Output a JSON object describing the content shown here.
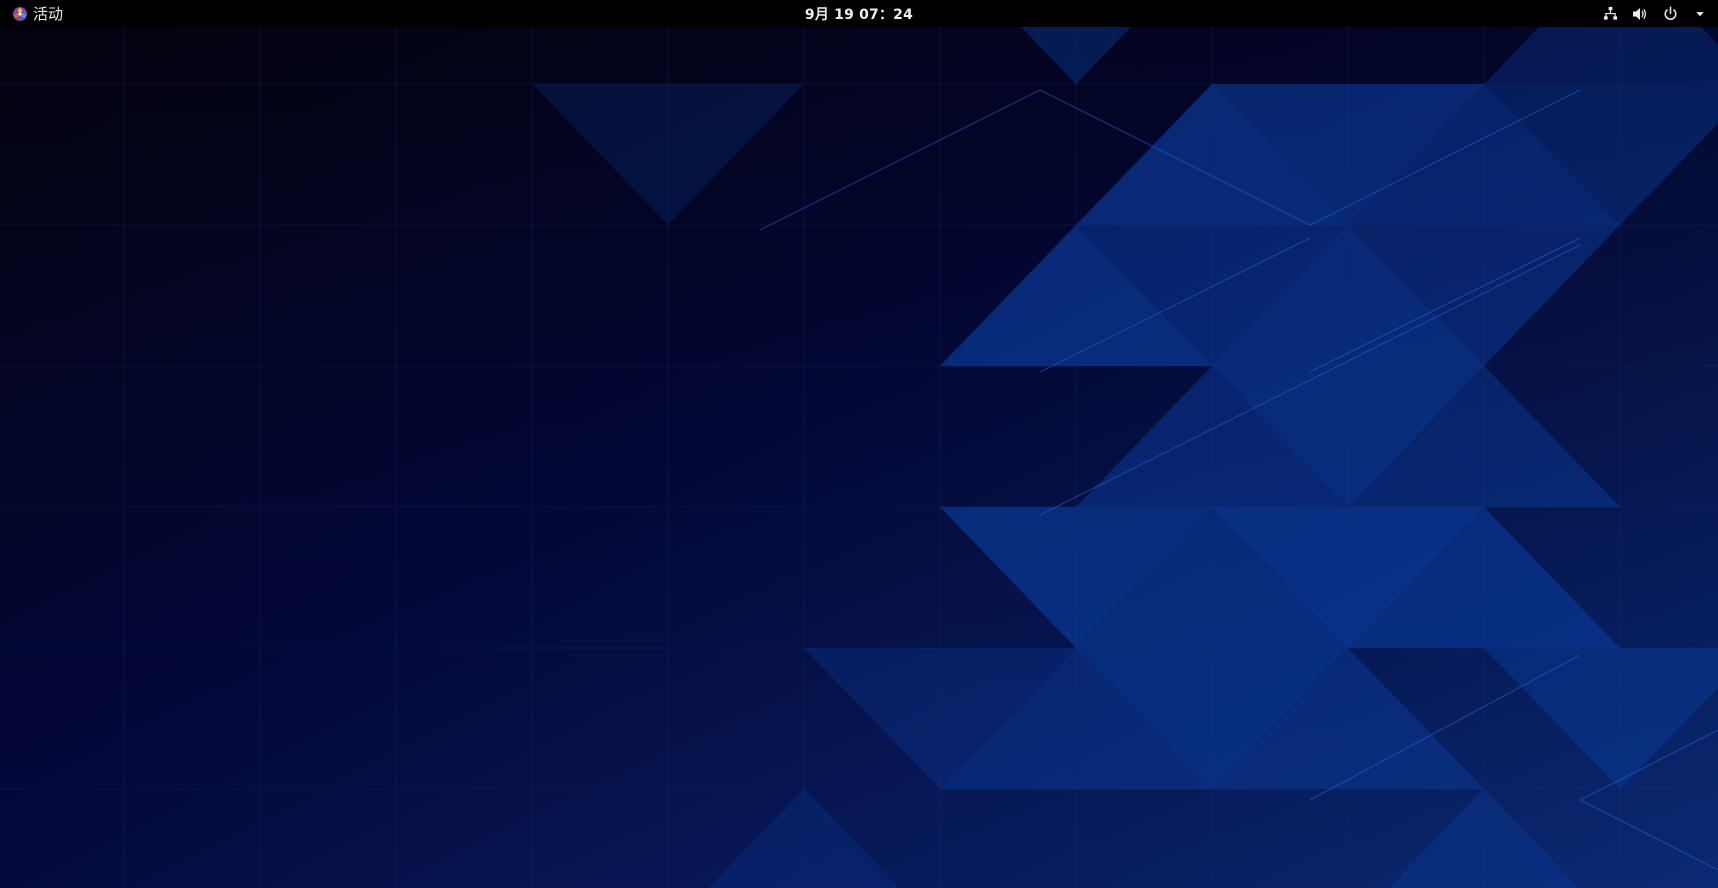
{
  "topbar": {
    "activities_label": "活动",
    "clock": "9月 19  07：24"
  },
  "tray": {
    "icons": [
      "network-icon",
      "volume-icon",
      "power-icon",
      "chevron-down-icon"
    ]
  },
  "colors": {
    "topbar_bg": "#000000",
    "topbar_text": "#eeeeec",
    "wallpaper_dark": "#03021a",
    "wallpaper_mid": "#0a1a55",
    "wallpaper_bright": "#0b3a96"
  }
}
